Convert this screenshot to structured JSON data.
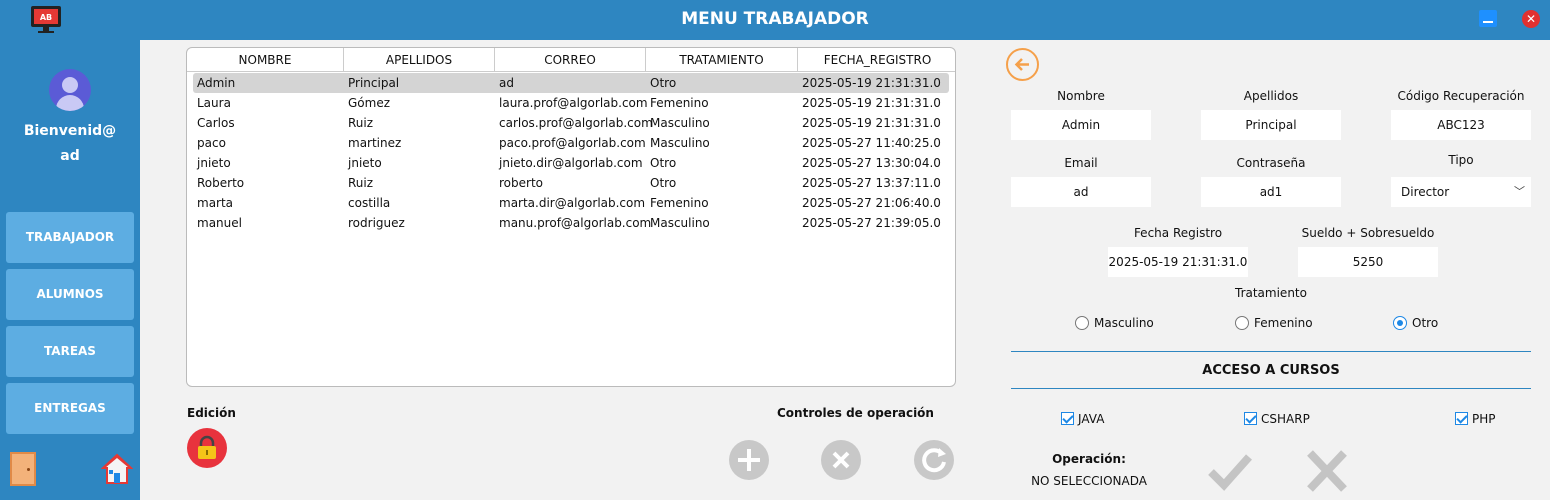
{
  "window": {
    "title": "MENU TRABAJADOR"
  },
  "sidebar": {
    "welcome_line1": "Bienvenid@",
    "welcome_line2": "ad",
    "items": [
      {
        "label": "TRABAJADOR"
      },
      {
        "label": "ALUMNOS"
      },
      {
        "label": "TAREAS"
      },
      {
        "label": "ENTREGAS"
      }
    ]
  },
  "table": {
    "columns": [
      "NOMBRE",
      "APELLIDOS",
      "CORREO",
      "TRATAMIENTO",
      "FECHA_REGISTRO"
    ],
    "rows": [
      [
        "Admin",
        "Principal",
        "ad",
        "Otro",
        "2025-05-19 21:31:31.0"
      ],
      [
        "Laura",
        "Gómez",
        "laura.prof@algorlab.com",
        "Femenino",
        "2025-05-19 21:31:31.0"
      ],
      [
        "Carlos",
        "Ruiz",
        "carlos.prof@algorlab.com",
        "Masculino",
        "2025-05-19 21:31:31.0"
      ],
      [
        "paco",
        "martinez",
        "paco.prof@algorlab.com",
        "Masculino",
        "2025-05-27 11:40:25.0"
      ],
      [
        "jnieto",
        "jnieto",
        "jnieto.dir@algorlab.com",
        "Otro",
        "2025-05-27 13:30:04.0"
      ],
      [
        "Roberto",
        "Ruiz",
        "roberto",
        "Otro",
        "2025-05-27 13:37:11.0"
      ],
      [
        "marta",
        "costilla",
        "marta.dir@algorlab.com",
        "Femenino",
        "2025-05-27 21:06:40.0"
      ],
      [
        "manuel",
        "rodriguez",
        "manu.prof@algorlab.com",
        "Masculino",
        "2025-05-27 21:39:05.0"
      ]
    ],
    "selected_row": 0
  },
  "edicion": {
    "label": "Edición"
  },
  "controles": {
    "label": "Controles de operación"
  },
  "form": {
    "nombre": {
      "label": "Nombre",
      "value": "Admin"
    },
    "apellidos": {
      "label": "Apellidos",
      "value": "Principal"
    },
    "codigo": {
      "label": "Código Recuperación",
      "value": "ABC123"
    },
    "email": {
      "label": "Email",
      "value": "ad"
    },
    "contrasena": {
      "label": "Contraseña",
      "value": "ad1"
    },
    "tipo": {
      "label": "Tipo",
      "value": "Director"
    },
    "fecha": {
      "label": "Fecha Registro",
      "value": "2025-05-19 21:31:31.0"
    },
    "sueldo": {
      "label": "Sueldo + Sobresueldo",
      "value": "5250"
    },
    "tratamiento": {
      "label": "Tratamiento",
      "options": [
        "Masculino",
        "Femenino",
        "Otro"
      ],
      "selected": "Otro"
    },
    "acceso": {
      "title": "ACCESO A CURSOS",
      "courses": [
        {
          "label": "JAVA",
          "checked": true
        },
        {
          "label": "CSHARP",
          "checked": true
        },
        {
          "label": "PHP",
          "checked": true
        }
      ]
    },
    "operacion": {
      "label": "Operación:",
      "value": "NO SELECCIONADA"
    }
  },
  "colors": {
    "accent": "#2e86c1",
    "sidebar_button": "#5dade2",
    "lock": "#e8333d",
    "back": "#f5a04a"
  }
}
